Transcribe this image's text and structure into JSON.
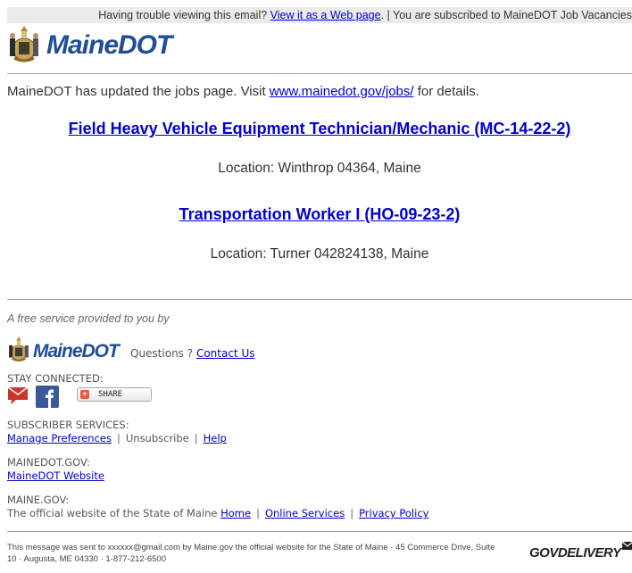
{
  "topbar": {
    "prefix": "Having trouble viewing this email?",
    "view_link": "View it as a Web page",
    "suffix": ". | You are subscribed to MaineDOT Job Vacancies"
  },
  "brand": {
    "name": "MaineDOT",
    "color": "#1f4e96"
  },
  "intro": {
    "text_before": "MaineDOT has updated the jobs page. Visit ",
    "link": "www.mainedot.gov/jobs/",
    "text_after": " for details."
  },
  "jobs": [
    {
      "title": "Field Heavy Vehicle Equipment Technician/Mechanic (MC-14-22-2)",
      "location": "Location: Winthrop 04364, Maine"
    },
    {
      "title": "Transportation Worker I (HO-09-23-2)",
      "location": "Location: Turner 042824138, Maine"
    }
  ],
  "footer": {
    "free_service": "A free service provided to you by",
    "questions": "Questions ?",
    "contact_link": "Contact Us",
    "stay_connected": "STAY CONNECTED:",
    "share_label": "SHARE",
    "subscriber_services": "SUBSCRIBER SERVICES:",
    "manage_preferences": "Manage Preferences",
    "unsubscribe": "Unsubscribe",
    "help": "Help",
    "mainedot_gov": "MAINEDOT.GOV:",
    "mainedot_website": "MaineDOT Website",
    "maine_gov": "MAINE.GOV:",
    "official_text": "The official website of the State of Maine",
    "home": "Home",
    "online_services": "Online Services",
    "privacy_policy": "Privacy Policy",
    "separator": "|"
  },
  "legal": {
    "line1": "This message was sent to xxxxxx@gmail.com by Maine.gov the official website for the State of Maine · 45 Commerce Drive, Suite",
    "line2": "10 · Augusta, ME 04330 · 1-877-212-6500",
    "govdelivery": "GOVDELIVERY"
  },
  "colors": {
    "link": "#0000cc",
    "topbar_bg": "#ebebeb",
    "divider": "#a0a0a0"
  }
}
